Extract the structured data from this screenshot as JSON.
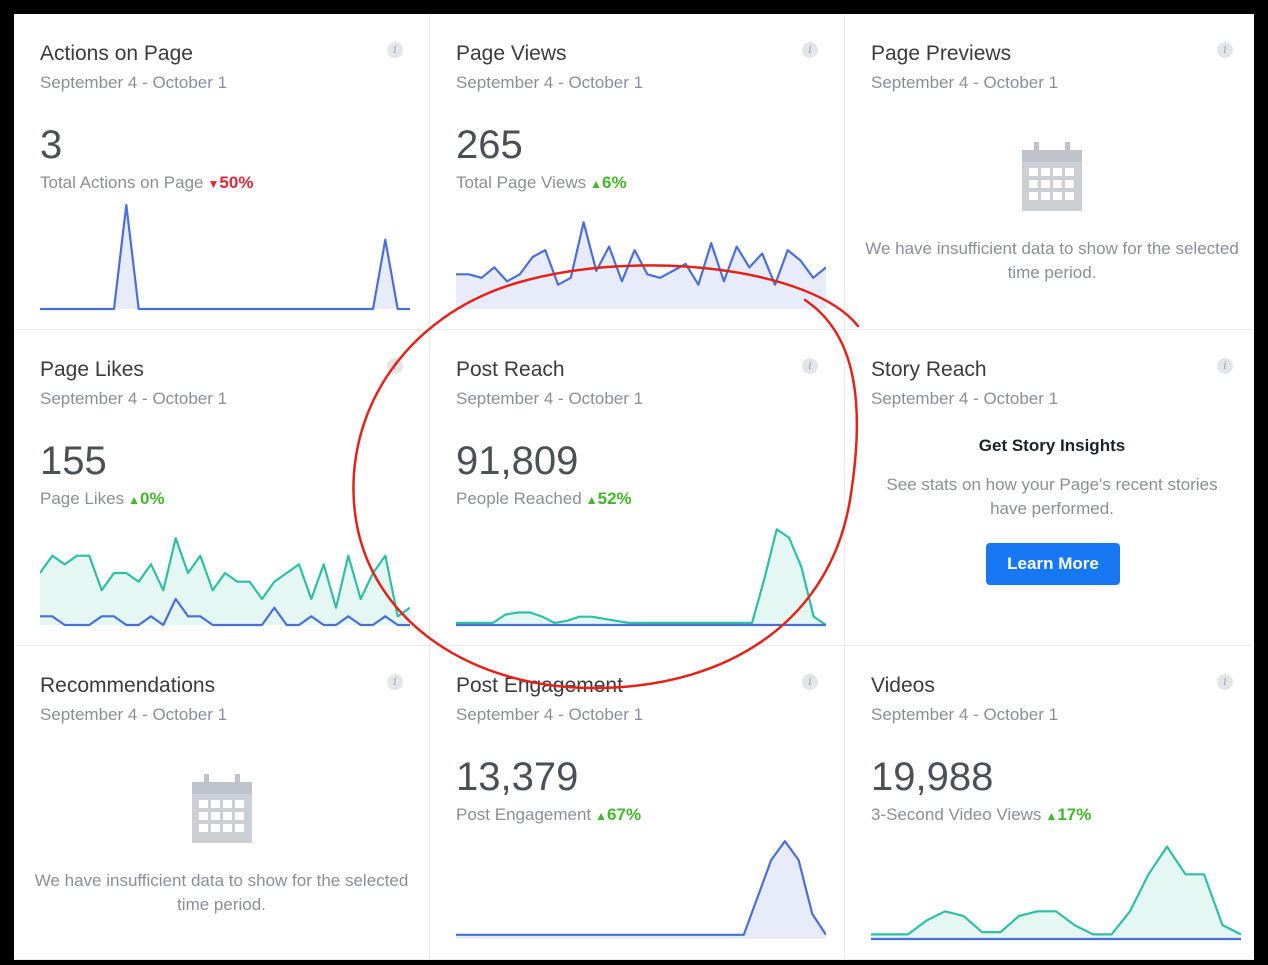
{
  "date_range": "September 4 - October 1",
  "info_label": "i",
  "insufficient": "We have insufficient data to show for the selected time period.",
  "colors": {
    "blue": "#4b6fd6",
    "teal": "#2ebfa5",
    "red_annotation": "#e2231a",
    "button": "#1877f2",
    "up": "#42b72a",
    "down": "#e0273a"
  },
  "cards": {
    "actions": {
      "title": "Actions on Page",
      "value": "3",
      "sub": "Total Actions on Page",
      "arrow": "▼",
      "change": "50%",
      "trend": "down"
    },
    "views": {
      "title": "Page Views",
      "value": "265",
      "sub": "Total Page Views",
      "arrow": "▲",
      "change": "6%",
      "trend": "up"
    },
    "previews": {
      "title": "Page Previews",
      "icon": "calendar-icon"
    },
    "likes": {
      "title": "Page Likes",
      "value": "155",
      "sub": "Page Likes",
      "arrow": "▲",
      "change": "0%",
      "trend": "up"
    },
    "reach": {
      "title": "Post Reach",
      "value": "91,809",
      "sub": "People Reached",
      "arrow": "▲",
      "change": "52%",
      "trend": "up"
    },
    "story": {
      "title": "Story Reach",
      "heading": "Get Story Insights",
      "text": "See stats on how your Page's recent stories have performed.",
      "button": "Learn More"
    },
    "recommendations": {
      "title": "Recommendations",
      "icon": "calendar-icon"
    },
    "engagement": {
      "title": "Post Engagement",
      "value": "13,379",
      "sub": "Post Engagement",
      "arrow": "▲",
      "change": "67%",
      "trend": "up"
    },
    "videos": {
      "title": "Videos",
      "value": "19,988",
      "sub": "3-Second Video Views",
      "arrow": "▲",
      "change": "17%",
      "trend": "up"
    }
  },
  "chart_data": [
    {
      "type": "line",
      "card": "actions",
      "ylim": [
        0,
        3
      ],
      "series": [
        {
          "color": "#4b6fd6",
          "fill": true,
          "values": [
            0,
            0,
            0,
            0,
            0,
            0,
            0,
            3,
            0,
            0,
            0,
            0,
            0,
            0,
            0,
            0,
            0,
            0,
            0,
            0,
            0,
            0,
            0,
            0,
            0,
            0,
            0,
            0,
            2,
            0,
            0
          ]
        }
      ]
    },
    {
      "type": "line",
      "card": "views",
      "ylim": [
        0,
        30
      ],
      "series": [
        {
          "color": "#4b6fd6",
          "fill": true,
          "values": [
            10,
            10,
            9,
            12,
            8,
            10,
            15,
            17,
            7,
            9,
            25,
            11,
            18,
            8,
            17,
            10,
            9,
            11,
            13,
            7,
            19,
            8,
            18,
            12,
            16,
            7,
            17,
            14,
            9,
            12
          ]
        }
      ]
    },
    {
      "type": "line",
      "card": "likes",
      "ylim": [
        0,
        12
      ],
      "series": [
        {
          "color": "#2ebfa5",
          "fill": true,
          "values": [
            6,
            8,
            7,
            8,
            8,
            4,
            6,
            6,
            5,
            7,
            4,
            10,
            6,
            8,
            4,
            6,
            5,
            5,
            3,
            5,
            6,
            7,
            3,
            7,
            2,
            8,
            3,
            6,
            8,
            1,
            2
          ]
        },
        {
          "color": "#4b6fd6",
          "fill": false,
          "values": [
            1,
            1,
            0,
            0,
            0,
            1,
            1,
            0,
            0,
            1,
            0,
            3,
            1,
            1,
            0,
            0,
            0,
            0,
            0,
            2,
            0,
            0,
            1,
            0,
            0,
            1,
            0,
            0,
            1,
            0,
            0
          ]
        }
      ]
    },
    {
      "type": "line",
      "card": "reach",
      "ylim": [
        0,
        50
      ],
      "series": [
        {
          "color": "#2ebfa5",
          "fill": true,
          "values": [
            1,
            1,
            1,
            1,
            5,
            6,
            6,
            4,
            1,
            2,
            4,
            4,
            3,
            2,
            1,
            1,
            1,
            1,
            1,
            1,
            1,
            1,
            1,
            1,
            1,
            22,
            46,
            42,
            28,
            4,
            0
          ]
        },
        {
          "color": "#4b6fd6",
          "fill": false,
          "values": [
            0,
            0,
            0,
            0,
            0,
            0,
            0,
            0,
            0,
            0,
            0,
            0,
            0,
            0,
            0,
            0,
            0,
            0,
            0,
            0,
            0,
            0,
            0,
            0,
            0,
            0,
            0,
            0,
            0,
            0,
            0
          ]
        }
      ]
    },
    {
      "type": "line",
      "card": "engagement",
      "ylim": [
        0,
        50
      ],
      "series": [
        {
          "color": "#4b6fd6",
          "fill": true,
          "values": [
            2,
            2,
            2,
            2,
            2,
            2,
            2,
            2,
            2,
            2,
            2,
            2,
            2,
            2,
            2,
            2,
            2,
            2,
            2,
            2,
            2,
            2,
            20,
            38,
            47,
            38,
            12,
            2
          ]
        }
      ]
    },
    {
      "type": "line",
      "card": "videos",
      "ylim": [
        0,
        45
      ],
      "series": [
        {
          "color": "#2ebfa5",
          "fill": true,
          "values": [
            2,
            2,
            2,
            8,
            12,
            10,
            3,
            3,
            10,
            12,
            12,
            6,
            2,
            2,
            12,
            28,
            40,
            28,
            28,
            6,
            2
          ]
        },
        {
          "color": "#4b6fd6",
          "fill": false,
          "values": [
            0,
            0,
            0,
            0,
            0,
            0,
            0,
            0,
            0,
            0,
            0,
            0,
            0,
            0,
            0,
            0,
            0,
            0,
            0,
            0,
            0
          ]
        }
      ]
    }
  ]
}
